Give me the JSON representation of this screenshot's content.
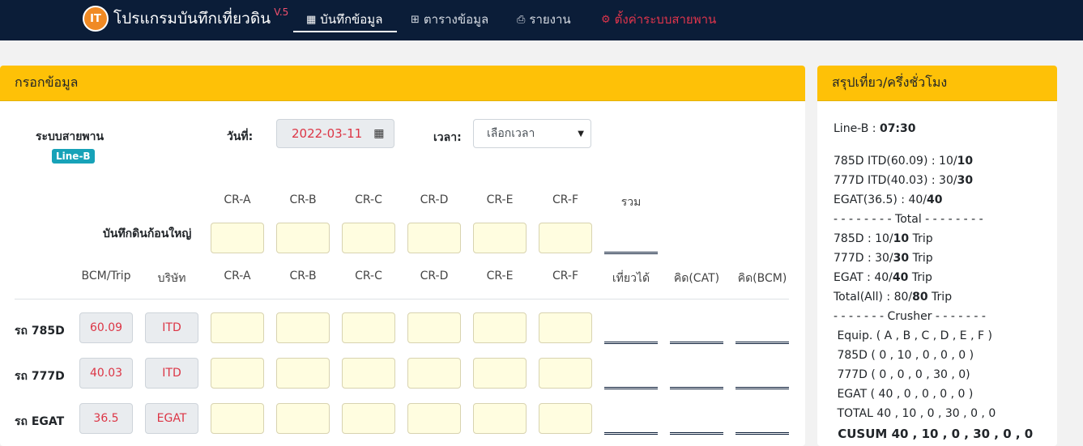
{
  "nav": {
    "logo_text": "IT",
    "brand": "โปรแกรมบันทึกเที่ยวดิน",
    "version": "V.5",
    "items": [
      {
        "label": "บันทึกข้อมูล"
      },
      {
        "label": "ตารางข้อมูล"
      },
      {
        "label": "รายงาน"
      },
      {
        "label": "ตั้งค่าระบบสายพาน"
      }
    ]
  },
  "form": {
    "header": "กรอกข้อมูล",
    "belt_label": "ระบบสายพาน",
    "belt_badge": "Line-B",
    "date_label": "วันที่:",
    "date_value": "2022-03-11",
    "time_label": "เวลา:",
    "time_selected": "เลือกเวลา",
    "big_rock_label": "บันทึกดินก้อนใหญ่",
    "cr_headers": [
      "CR-A",
      "CR-B",
      "CR-C",
      "CR-D",
      "CR-E",
      "CR-F"
    ],
    "total_header": "รวม",
    "col_bcm_trip": "BCM/Trip",
    "col_company": "บริษัท",
    "col_trips": "เที่ยวได้",
    "col_cat": "คิด(CAT)",
    "col_bcm": "คิด(BCM)",
    "rows": [
      {
        "label": "รถ 785D",
        "bcm": "60.09",
        "company": "ITD"
      },
      {
        "label": "รถ 777D",
        "bcm": "40.03",
        "company": "ITD"
      },
      {
        "label": "รถ EGAT",
        "bcm": "36.5",
        "company": "EGAT"
      }
    ]
  },
  "summary": {
    "header": "สรุปเที่ยว/ครึ่งชั่วโมง",
    "line_prefix": "Line-B : ",
    "line_time": "07:30",
    "items": [
      {
        "pre": "785D ITD(60.09) : 10/",
        "b": "10",
        "post": ""
      },
      {
        "pre": "777D ITD(40.03) : 30/",
        "b": "30",
        "post": ""
      },
      {
        "pre": "EGAT(36.5) : 40/",
        "b": "40",
        "post": ""
      },
      {
        "pre": "- - - - - - - - Total - - - - - - - -",
        "b": "",
        "post": ""
      },
      {
        "pre": "785D : 10/",
        "b": "10",
        "post": " Trip"
      },
      {
        "pre": "777D : 30/",
        "b": "30",
        "post": " Trip"
      },
      {
        "pre": "EGAT : 40/",
        "b": "40",
        "post": " Trip"
      },
      {
        "pre": "Total(All) : 80/",
        "b": "80",
        "post": " Trip"
      },
      {
        "pre": "- - - - - - - Crusher - - - - - - -",
        "b": "",
        "post": ""
      },
      {
        "pre": " Equip. ( A , B , C , D , E , F )",
        "b": "",
        "post": ""
      },
      {
        "pre": " 785D ( 0 , 10 , 0 , 0 , 0 )",
        "b": "",
        "post": ""
      },
      {
        "pre": " 777D ( 0 , 0 , 0 , 30 , 0)",
        "b": "",
        "post": ""
      },
      {
        "pre": " EGAT ( 40 , 0 , 0 , 0 , 0 )",
        "b": "",
        "post": ""
      },
      {
        "pre": " TOTAL 40 , 10 , 0 , 30 , 0 , 0",
        "b": "",
        "post": ""
      }
    ],
    "cusum_label": "CUSUM",
    "cusum_value": "40 , 10 , 0 , 30 , 0 , 0"
  }
}
